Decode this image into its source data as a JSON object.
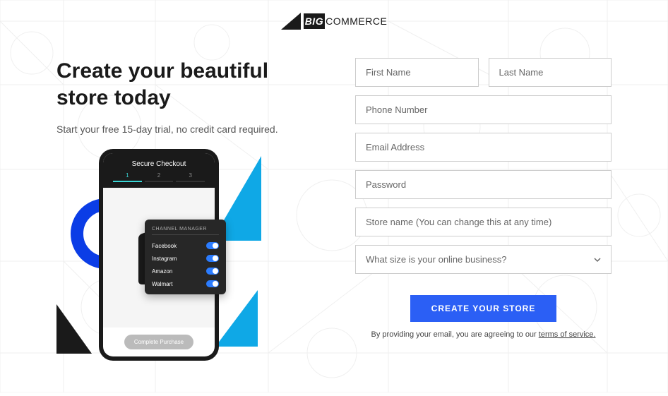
{
  "brand": {
    "big": "BIG",
    "commerce": "COMMERCE"
  },
  "hero": {
    "title": "Create your beautiful store today",
    "subtitle": "Start your free 15-day trial, no credit card required."
  },
  "phone": {
    "checkout_title": "Secure Checkout",
    "step1": "1",
    "step2": "2",
    "step3": "3",
    "purchase_label": "Complete Purchase"
  },
  "channel_manager": {
    "title": "CHANNEL MANAGER",
    "rows": [
      "Facebook",
      "Instagram",
      "Amazon",
      "Walmart"
    ]
  },
  "form": {
    "first_name": "First Name",
    "last_name": "Last Name",
    "phone": "Phone Number",
    "email": "Email Address",
    "password": "Password",
    "store_name": "Store name (You can change this at any time)",
    "business_size": "What size is your online business?",
    "submit": "CREATE YOUR STORE",
    "disclaimer_prefix": "By providing your email, you are agreeing to our ",
    "disclaimer_link": "terms of service."
  }
}
